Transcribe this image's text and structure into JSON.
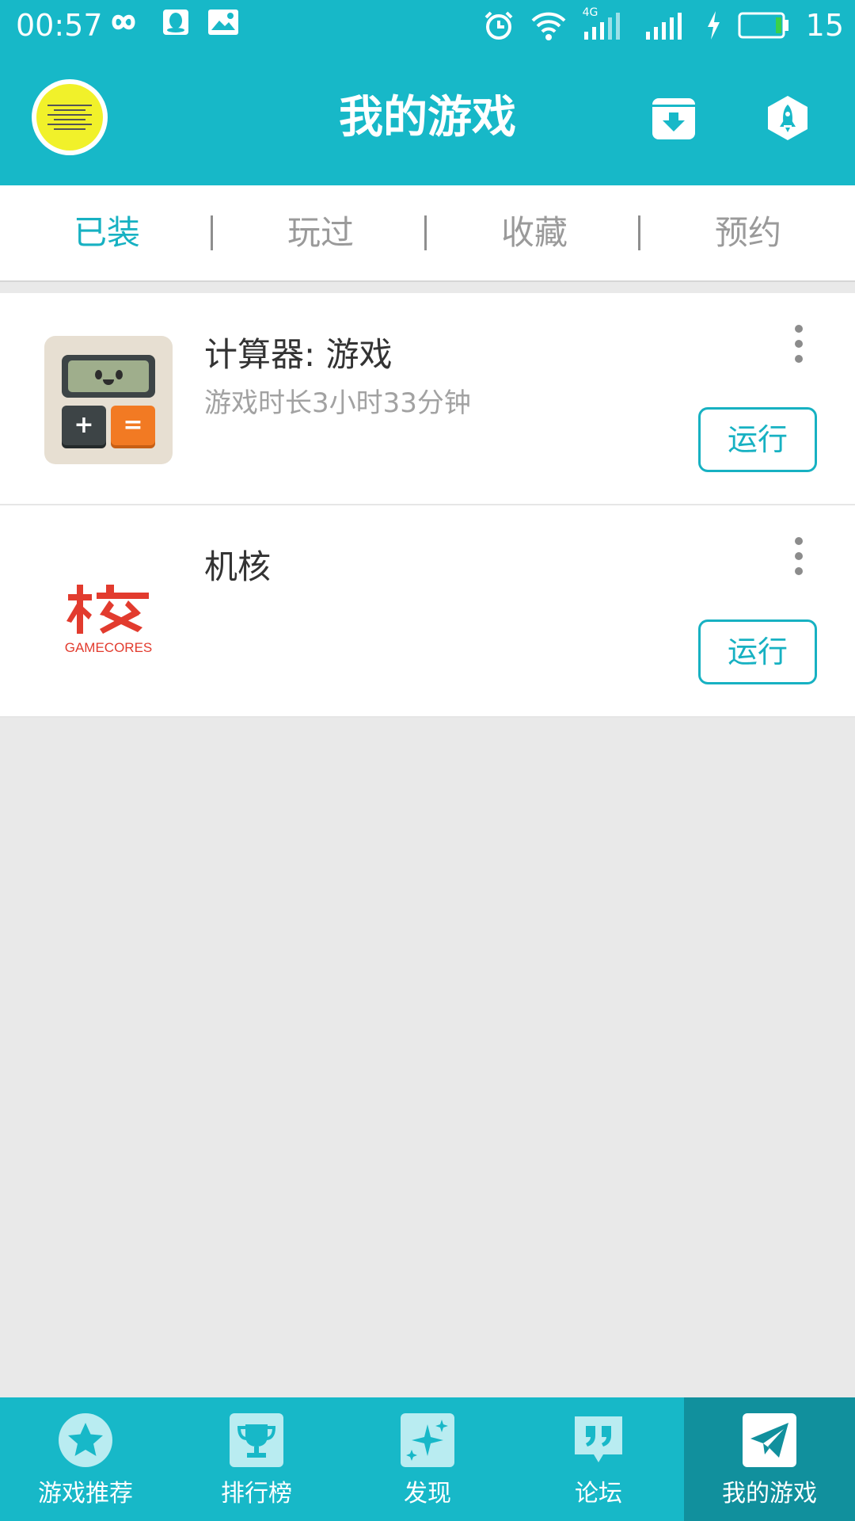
{
  "status_bar": {
    "time": "00:57",
    "network": "4G",
    "battery": "15",
    "left_icons": [
      "infinity-icon",
      "qq-icon",
      "image-icon"
    ],
    "right_icons": [
      "alarm-icon",
      "wifi-icon",
      "signal-icon",
      "signal-icon",
      "charging-icon",
      "battery-icon"
    ]
  },
  "header": {
    "title": "我的游戏",
    "avatar_icon": "avatar-image",
    "download_icon": "download-box-icon",
    "rocket_icon": "rocket-icon"
  },
  "tabs": [
    {
      "label": "已装",
      "active": true
    },
    {
      "label": "玩过",
      "active": false
    },
    {
      "label": "收藏",
      "active": false
    },
    {
      "label": "预约",
      "active": false
    }
  ],
  "games": [
    {
      "name": "计算器: 游戏",
      "subtitle": "游戏时长3小时33分钟",
      "run_label": "运行",
      "icon": "calculator-game-icon"
    },
    {
      "name": "机核",
      "subtitle": "",
      "run_label": "运行",
      "icon": "gamecores-icon",
      "icon_text": "GAMECORES"
    }
  ],
  "bottom_nav": [
    {
      "label": "游戏推荐",
      "icon": "star-icon",
      "active": false
    },
    {
      "label": "排行榜",
      "icon": "trophy-icon",
      "active": false
    },
    {
      "label": "发现",
      "icon": "sparkle-icon",
      "active": false
    },
    {
      "label": "论坛",
      "icon": "quote-icon",
      "active": false
    },
    {
      "label": "我的游戏",
      "icon": "paper-plane-icon",
      "active": true
    }
  ],
  "colors": {
    "primary": "#17b8c8",
    "accent_text": "#17b1c2",
    "nav_active": "#11909d",
    "background": "#e9e9e9"
  }
}
